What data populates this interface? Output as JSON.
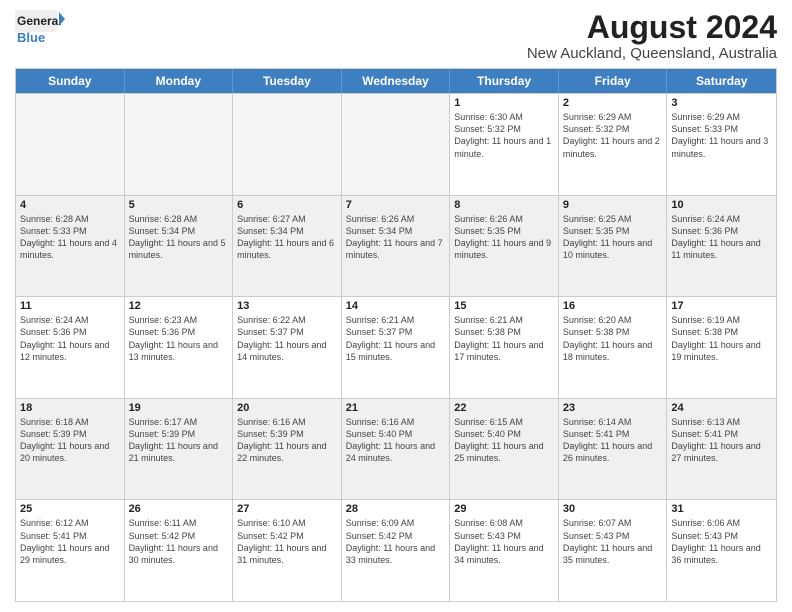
{
  "logo": {
    "line1": "General",
    "line2": "Blue"
  },
  "title": "August 2024",
  "subtitle": "New Auckland, Queensland, Australia",
  "header_days": [
    "Sunday",
    "Monday",
    "Tuesday",
    "Wednesday",
    "Thursday",
    "Friday",
    "Saturday"
  ],
  "rows": [
    [
      {
        "day": "",
        "info": "",
        "empty": true
      },
      {
        "day": "",
        "info": "",
        "empty": true
      },
      {
        "day": "",
        "info": "",
        "empty": true
      },
      {
        "day": "",
        "info": "",
        "empty": true
      },
      {
        "day": "1",
        "info": "Sunrise: 6:30 AM\nSunset: 5:32 PM\nDaylight: 11 hours and 1 minute.",
        "empty": false,
        "shaded": false
      },
      {
        "day": "2",
        "info": "Sunrise: 6:29 AM\nSunset: 5:32 PM\nDaylight: 11 hours and 2 minutes.",
        "empty": false,
        "shaded": false
      },
      {
        "day": "3",
        "info": "Sunrise: 6:29 AM\nSunset: 5:33 PM\nDaylight: 11 hours and 3 minutes.",
        "empty": false,
        "shaded": false
      }
    ],
    [
      {
        "day": "4",
        "info": "Sunrise: 6:28 AM\nSunset: 5:33 PM\nDaylight: 11 hours and 4 minutes.",
        "empty": false,
        "shaded": true
      },
      {
        "day": "5",
        "info": "Sunrise: 6:28 AM\nSunset: 5:34 PM\nDaylight: 11 hours and 5 minutes.",
        "empty": false,
        "shaded": true
      },
      {
        "day": "6",
        "info": "Sunrise: 6:27 AM\nSunset: 5:34 PM\nDaylight: 11 hours and 6 minutes.",
        "empty": false,
        "shaded": true
      },
      {
        "day": "7",
        "info": "Sunrise: 6:26 AM\nSunset: 5:34 PM\nDaylight: 11 hours and 7 minutes.",
        "empty": false,
        "shaded": true
      },
      {
        "day": "8",
        "info": "Sunrise: 6:26 AM\nSunset: 5:35 PM\nDaylight: 11 hours and 9 minutes.",
        "empty": false,
        "shaded": true
      },
      {
        "day": "9",
        "info": "Sunrise: 6:25 AM\nSunset: 5:35 PM\nDaylight: 11 hours and 10 minutes.",
        "empty": false,
        "shaded": true
      },
      {
        "day": "10",
        "info": "Sunrise: 6:24 AM\nSunset: 5:36 PM\nDaylight: 11 hours and 11 minutes.",
        "empty": false,
        "shaded": true
      }
    ],
    [
      {
        "day": "11",
        "info": "Sunrise: 6:24 AM\nSunset: 5:36 PM\nDaylight: 11 hours and 12 minutes.",
        "empty": false,
        "shaded": false
      },
      {
        "day": "12",
        "info": "Sunrise: 6:23 AM\nSunset: 5:36 PM\nDaylight: 11 hours and 13 minutes.",
        "empty": false,
        "shaded": false
      },
      {
        "day": "13",
        "info": "Sunrise: 6:22 AM\nSunset: 5:37 PM\nDaylight: 11 hours and 14 minutes.",
        "empty": false,
        "shaded": false
      },
      {
        "day": "14",
        "info": "Sunrise: 6:21 AM\nSunset: 5:37 PM\nDaylight: 11 hours and 15 minutes.",
        "empty": false,
        "shaded": false
      },
      {
        "day": "15",
        "info": "Sunrise: 6:21 AM\nSunset: 5:38 PM\nDaylight: 11 hours and 17 minutes.",
        "empty": false,
        "shaded": false
      },
      {
        "day": "16",
        "info": "Sunrise: 6:20 AM\nSunset: 5:38 PM\nDaylight: 11 hours and 18 minutes.",
        "empty": false,
        "shaded": false
      },
      {
        "day": "17",
        "info": "Sunrise: 6:19 AM\nSunset: 5:38 PM\nDaylight: 11 hours and 19 minutes.",
        "empty": false,
        "shaded": false
      }
    ],
    [
      {
        "day": "18",
        "info": "Sunrise: 6:18 AM\nSunset: 5:39 PM\nDaylight: 11 hours and 20 minutes.",
        "empty": false,
        "shaded": true
      },
      {
        "day": "19",
        "info": "Sunrise: 6:17 AM\nSunset: 5:39 PM\nDaylight: 11 hours and 21 minutes.",
        "empty": false,
        "shaded": true
      },
      {
        "day": "20",
        "info": "Sunrise: 6:16 AM\nSunset: 5:39 PM\nDaylight: 11 hours and 22 minutes.",
        "empty": false,
        "shaded": true
      },
      {
        "day": "21",
        "info": "Sunrise: 6:16 AM\nSunset: 5:40 PM\nDaylight: 11 hours and 24 minutes.",
        "empty": false,
        "shaded": true
      },
      {
        "day": "22",
        "info": "Sunrise: 6:15 AM\nSunset: 5:40 PM\nDaylight: 11 hours and 25 minutes.",
        "empty": false,
        "shaded": true
      },
      {
        "day": "23",
        "info": "Sunrise: 6:14 AM\nSunset: 5:41 PM\nDaylight: 11 hours and 26 minutes.",
        "empty": false,
        "shaded": true
      },
      {
        "day": "24",
        "info": "Sunrise: 6:13 AM\nSunset: 5:41 PM\nDaylight: 11 hours and 27 minutes.",
        "empty": false,
        "shaded": true
      }
    ],
    [
      {
        "day": "25",
        "info": "Sunrise: 6:12 AM\nSunset: 5:41 PM\nDaylight: 11 hours and 29 minutes.",
        "empty": false,
        "shaded": false
      },
      {
        "day": "26",
        "info": "Sunrise: 6:11 AM\nSunset: 5:42 PM\nDaylight: 11 hours and 30 minutes.",
        "empty": false,
        "shaded": false
      },
      {
        "day": "27",
        "info": "Sunrise: 6:10 AM\nSunset: 5:42 PM\nDaylight: 11 hours and 31 minutes.",
        "empty": false,
        "shaded": false
      },
      {
        "day": "28",
        "info": "Sunrise: 6:09 AM\nSunset: 5:42 PM\nDaylight: 11 hours and 33 minutes.",
        "empty": false,
        "shaded": false
      },
      {
        "day": "29",
        "info": "Sunrise: 6:08 AM\nSunset: 5:43 PM\nDaylight: 11 hours and 34 minutes.",
        "empty": false,
        "shaded": false
      },
      {
        "day": "30",
        "info": "Sunrise: 6:07 AM\nSunset: 5:43 PM\nDaylight: 11 hours and 35 minutes.",
        "empty": false,
        "shaded": false
      },
      {
        "day": "31",
        "info": "Sunrise: 6:06 AM\nSunset: 5:43 PM\nDaylight: 11 hours and 36 minutes.",
        "empty": false,
        "shaded": false
      }
    ]
  ]
}
